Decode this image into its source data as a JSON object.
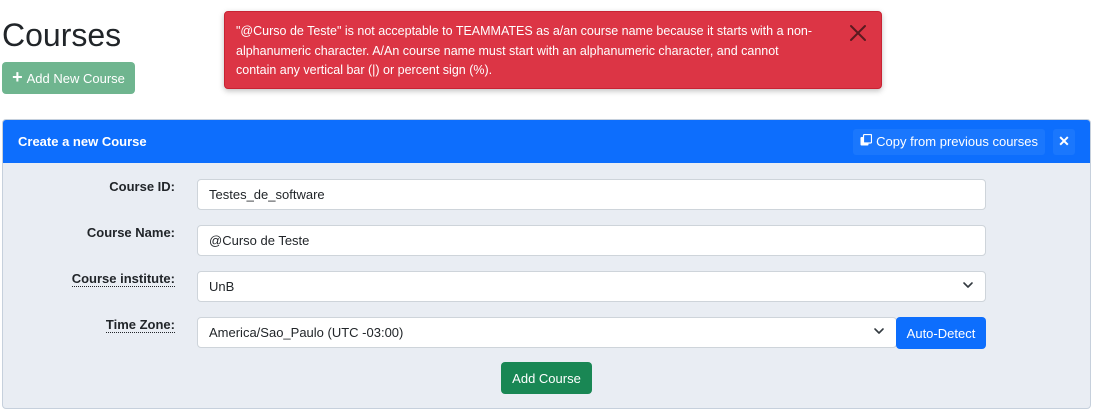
{
  "page": {
    "title": "Courses"
  },
  "toolbar": {
    "add_new_label": "Add New Course"
  },
  "alert": {
    "message": "\"@Curso de Teste\" is not acceptable to TEAMMATES as a/an course name because it starts with a non-alphanumeric character. A/An course name must start with an alphanumeric character, and cannot contain any vertical bar (|) or percent sign (%).",
    "type_color": "#dc3545"
  },
  "panel": {
    "title": "Create a new Course",
    "copy_label": "Copy from previous courses",
    "close_label": "✕",
    "header_color": "#0d6efd"
  },
  "form": {
    "course_id": {
      "label": "Course ID:",
      "value": "Testes_de_software"
    },
    "course_name": {
      "label": "Course Name:",
      "value": "@Curso de Teste"
    },
    "institute": {
      "label": "Course institute:",
      "value": "UnB"
    },
    "timezone": {
      "label": "Time Zone:",
      "value": "America/Sao_Paulo (UTC -03:00)",
      "auto_detect_label": "Auto-Detect"
    },
    "submit_label": "Add Course"
  }
}
